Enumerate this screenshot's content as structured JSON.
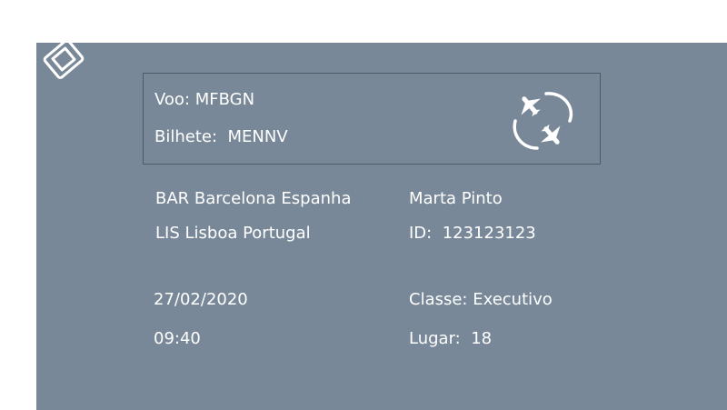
{
  "flight": {
    "voo_label": "Voo:",
    "voo_value": "MFBGN",
    "bilhete_label": "Bilhete:",
    "bilhete_value": "MENNV"
  },
  "route": {
    "origin": "BAR Barcelona Espanha",
    "destination": "LIS Lisboa Portugal"
  },
  "passenger": {
    "name": "Marta Pinto",
    "id_label": "ID:",
    "id_value": "123123123"
  },
  "schedule": {
    "date": "27/02/2020",
    "time": "09:40"
  },
  "seat": {
    "classe_label": "Classe:",
    "classe_value": "Executivo",
    "lugar_label": "Lugar:",
    "lugar_value": "18"
  },
  "icons": {
    "ticket": "ticket-icon",
    "flights": "planes-exchange-icon"
  },
  "colors": {
    "panel": "#798898",
    "text": "#ffffff",
    "border": "#4f5a66"
  }
}
